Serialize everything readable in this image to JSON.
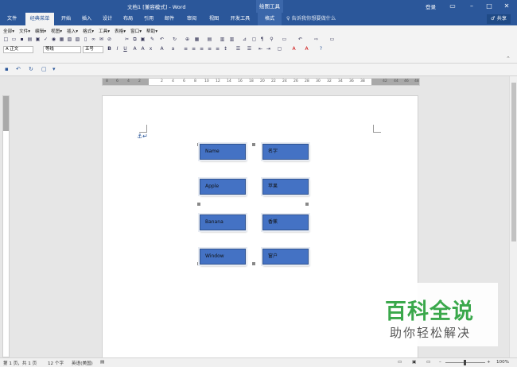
{
  "window": {
    "title": "文档1 [兼容模式] - Word",
    "context_tab": "绘图工具",
    "login": "登录",
    "ribbon_display_icon": "ribbon-display-icon",
    "minimize_icon": "minimize-icon",
    "maximize_icon": "maximize-icon",
    "close_icon": "close-icon"
  },
  "tabs": [
    "文件",
    "经典菜单",
    "开始",
    "插入",
    "设计",
    "布局",
    "引用",
    "邮件",
    "审阅",
    "视图",
    "开发工具",
    "格式"
  ],
  "active_tab": "经典菜单",
  "tell_me": "告诉我你想要做什么",
  "share": "共享",
  "classic_menu": [
    "全部▾",
    "文件▾",
    "编辑▾",
    "视图▾",
    "插入▾",
    "格式▾",
    "工具▾",
    "表格▾",
    "窗口▾",
    "帮助▾"
  ],
  "format": {
    "style": "正文",
    "font": "等线",
    "size": "五号",
    "bold": "B",
    "italic": "I",
    "underline": "U"
  },
  "qat": {
    "save_icon": "save-icon",
    "undo_icon": "undo-icon",
    "redo_icon": "redo-icon"
  },
  "ruler": {
    "left_numbers": [
      "8",
      "6",
      "4",
      "2"
    ],
    "numbers": [
      "2",
      "4",
      "6",
      "8",
      "10",
      "12",
      "14",
      "16",
      "18",
      "20",
      "22",
      "24",
      "26",
      "28",
      "30",
      "32",
      "34",
      "36",
      "38"
    ],
    "right_numbers": [
      "42",
      "44",
      "46",
      "48"
    ]
  },
  "document": {
    "boxes": [
      {
        "text": "Name"
      },
      {
        "text": "名字"
      },
      {
        "text": "Apple"
      },
      {
        "text": "苹果"
      },
      {
        "text": "Banana"
      },
      {
        "text": "香蕉"
      },
      {
        "text": "Window"
      },
      {
        "text": "窗户"
      }
    ],
    "box_color": "#4472c4"
  },
  "status": {
    "page": "第 1 页，共 1 页",
    "words": "12 个字",
    "language": "英语(美国)",
    "zoom": "100%"
  },
  "watermark": {
    "line1": "百科全说",
    "line2": "助你轻松解决",
    "color": "#3aa84b"
  }
}
